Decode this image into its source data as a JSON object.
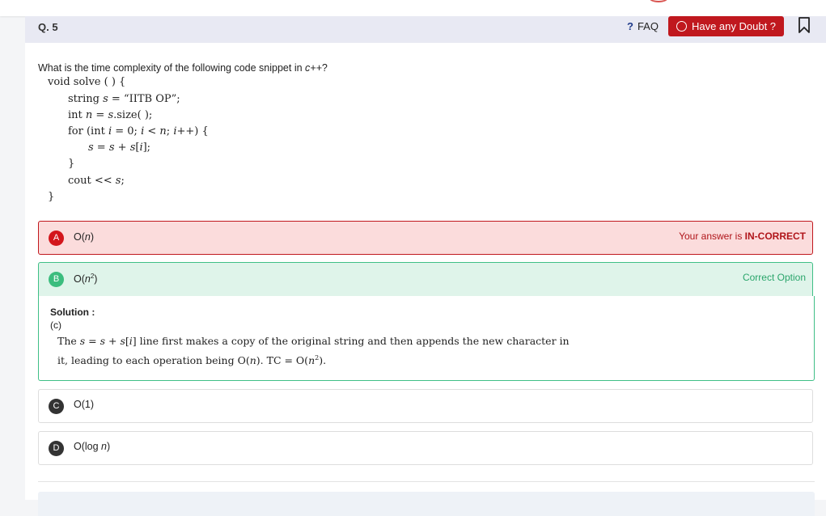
{
  "question": {
    "number": "Q. 5",
    "prompt_prefix": "What is the time complexity of the following code snippet in ",
    "prompt_lang": "c++",
    "prompt_suffix": "?"
  },
  "header": {
    "faq_mark": "?",
    "faq_label": "FAQ",
    "doubt_label": "Have any Doubt ?"
  },
  "code_lines": {
    "l1": "void solve ( ) {",
    "l2a": "string ",
    "l2v": "s",
    "l2b": " = “IITB OP”;",
    "l3a": "int ",
    "l3v": "n",
    "l3b": " = ",
    "l3v2": "s",
    "l3c": ".size( );",
    "l4a": "for (int ",
    "l4v1": "i",
    "l4b": " = 0; ",
    "l4v2": "i",
    "l4c": " < ",
    "l4v3": "n",
    "l4d": "; ",
    "l4v4": "i",
    "l4e": "++) {",
    "l5v1": "s",
    "l5a": " = ",
    "l5v2": "s",
    "l5b": " + ",
    "l5v3": "s",
    "l5c": "[",
    "l5v4": "i",
    "l5d": "];",
    "l6": "}",
    "l7a": "cout << ",
    "l7v": "s",
    "l7b": ";",
    "l8": "}"
  },
  "options": {
    "a": {
      "letter": "A",
      "pre": "O(",
      "var": "n",
      "post": ")",
      "status_prefix": "Your answer is ",
      "status_strong": "IN-CORRECT"
    },
    "b": {
      "letter": "B",
      "pre": "O(",
      "var": "n",
      "sup": "2",
      "post": ")",
      "status": "Correct Option"
    },
    "c": {
      "letter": "C",
      "text": "O(1)"
    },
    "d": {
      "letter": "D",
      "pre": "O(log ",
      "var": "n",
      "post": ")"
    }
  },
  "solution": {
    "title": "Solution :",
    "answer": "(c)",
    "t1": "The ",
    "v1": "s",
    "t2": " = ",
    "v2": "s",
    "t3": " + ",
    "v3": "s",
    "t4": "[",
    "v4": "i",
    "t5": "] line first makes a copy of the original string and then appends the new character in it, leading to each operation being O(",
    "v5": "n",
    "t6": "). TC = O(",
    "v6": "n",
    "sup": "2",
    "t7": ")."
  },
  "colors": {
    "danger": "#c0181e",
    "success": "#3bbd7e",
    "header_bg": "#e8e9f3"
  },
  "icons": {
    "faq": "question-mark-icon",
    "doubt": "chat-bubble-icon",
    "bookmark": "bookmark-icon"
  }
}
